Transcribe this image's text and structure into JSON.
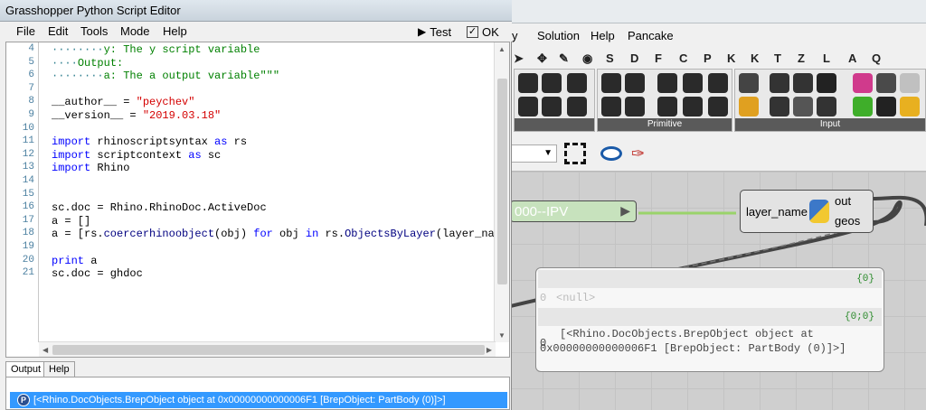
{
  "editor": {
    "title": "Grasshopper Python Script Editor",
    "menu": [
      "File",
      "Edit",
      "Tools",
      "Mode",
      "Help"
    ],
    "test_label": "Test",
    "ok_label": "OK",
    "lines": [
      {
        "n": "4",
        "parts": [
          {
            "t": "········",
            "c": "dots"
          },
          {
            "t": "y: The y script variable",
            "c": "doc"
          }
        ]
      },
      {
        "n": "5",
        "parts": [
          {
            "t": "····",
            "c": "dots"
          },
          {
            "t": "Output:",
            "c": "doc"
          }
        ]
      },
      {
        "n": "6",
        "parts": [
          {
            "t": "········",
            "c": "dots"
          },
          {
            "t": "a: The a output variable\"\"\"",
            "c": "doc"
          }
        ]
      },
      {
        "n": "7",
        "parts": []
      },
      {
        "n": "8",
        "parts": [
          {
            "t": "__author__ = ",
            "c": ""
          },
          {
            "t": "\"peychev\"",
            "c": "str"
          }
        ]
      },
      {
        "n": "9",
        "parts": [
          {
            "t": "__version__ = ",
            "c": ""
          },
          {
            "t": "\"2019.03.18\"",
            "c": "str"
          }
        ]
      },
      {
        "n": "10",
        "parts": []
      },
      {
        "n": "11",
        "parts": [
          {
            "t": "import",
            "c": "kw"
          },
          {
            "t": " rhinoscriptsyntax ",
            "c": ""
          },
          {
            "t": "as",
            "c": "kw"
          },
          {
            "t": " rs",
            "c": ""
          }
        ]
      },
      {
        "n": "12",
        "parts": [
          {
            "t": "import",
            "c": "kw"
          },
          {
            "t": " scriptcontext ",
            "c": ""
          },
          {
            "t": "as",
            "c": "kw"
          },
          {
            "t": " sc",
            "c": ""
          }
        ]
      },
      {
        "n": "13",
        "parts": [
          {
            "t": "import",
            "c": "kw"
          },
          {
            "t": " Rhino",
            "c": ""
          }
        ]
      },
      {
        "n": "14",
        "parts": []
      },
      {
        "n": "15",
        "parts": []
      },
      {
        "n": "16",
        "parts": [
          {
            "t": "sc.doc = Rhino.RhinoDoc.ActiveDoc",
            "c": ""
          }
        ]
      },
      {
        "n": "17",
        "parts": [
          {
            "t": "a = []",
            "c": ""
          }
        ]
      },
      {
        "n": "18",
        "parts": [
          {
            "t": "a = [rs.",
            "c": ""
          },
          {
            "t": "coercerhinoobject",
            "c": "fn"
          },
          {
            "t": "(obj) ",
            "c": ""
          },
          {
            "t": "for",
            "c": "kw"
          },
          {
            "t": " obj ",
            "c": ""
          },
          {
            "t": "in",
            "c": "kw"
          },
          {
            "t": " rs.",
            "c": ""
          },
          {
            "t": "ObjectsByLayer",
            "c": "fn"
          },
          {
            "t": "(layer_name)]",
            "c": ""
          }
        ]
      },
      {
        "n": "19",
        "parts": []
      },
      {
        "n": "20",
        "parts": [
          {
            "t": "print",
            "c": "kw"
          },
          {
            "t": " a",
            "c": ""
          }
        ]
      },
      {
        "n": "21",
        "parts": [
          {
            "t": "sc.doc = ghdoc",
            "c": ""
          }
        ]
      }
    ],
    "output_tabs": [
      "Output",
      "Help"
    ],
    "output_line": "[<Rhino.DocObjects.BrepObject object at 0x00000000000006F1 [BrepObject: PartBody (0)]>]"
  },
  "grasshopper": {
    "menu": [
      "y",
      "Solution",
      "Help",
      "Pancake"
    ],
    "tabs": [
      "S",
      "D",
      "F",
      "C",
      "P",
      "K",
      "K",
      "T",
      "Z",
      "L",
      "A",
      "Q"
    ],
    "group_labels": [
      "Primitive",
      "Input"
    ],
    "slider_text": "000--IPV",
    "node": {
      "input": "layer_name",
      "outputs": [
        "out",
        "geos"
      ]
    },
    "panel": {
      "branch1": "{0}",
      "item1_index": "0",
      "item1_value": "<null>",
      "branch2": "{0;0}",
      "item2_index": "0",
      "item2_line1": "[<Rhino.DocObjects.BrepObject object at",
      "item2_line2": "0x00000000000006F1 [BrepObject: PartBody (0)]>]"
    },
    "icons": {
      "eye": "eye-icon",
      "brush": "brush-icon",
      "select": "select-icon"
    }
  },
  "colors": {
    "selection": "#3399ff",
    "keyword": "#0000ff",
    "string": "#d40000",
    "docstring": "#008000",
    "slider_bg": "#c7e2bd"
  }
}
